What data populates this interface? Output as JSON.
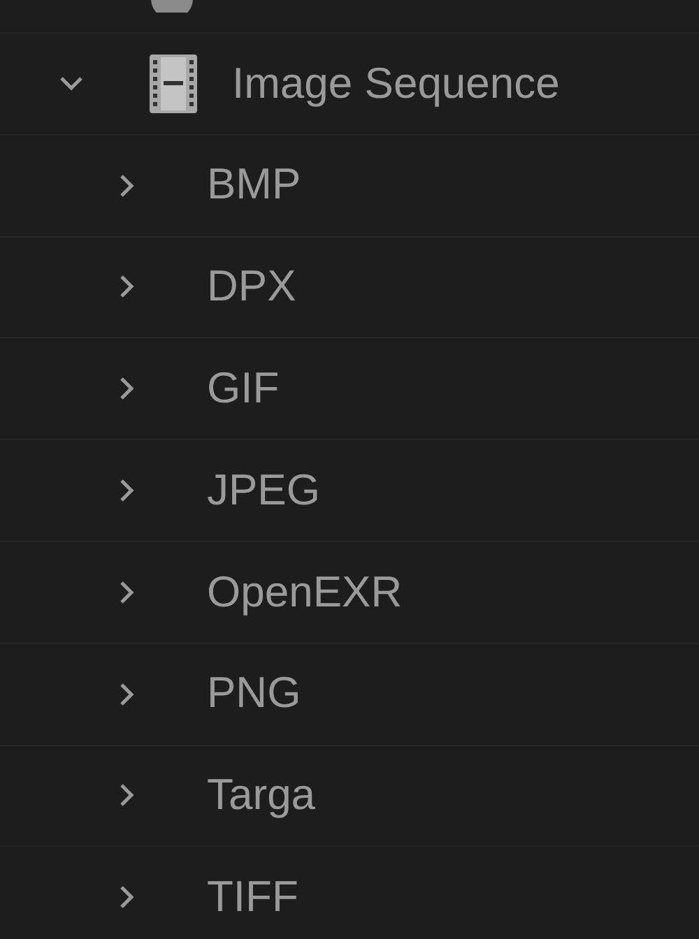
{
  "tree": [
    {
      "label": "Image Sequence",
      "expanded": true,
      "children": [
        {
          "label": "BMP",
          "expanded": false
        },
        {
          "label": "DPX",
          "expanded": false
        },
        {
          "label": "GIF",
          "expanded": false
        },
        {
          "label": "JPEG",
          "expanded": false
        },
        {
          "label": "OpenEXR",
          "expanded": false
        },
        {
          "label": "PNG",
          "expanded": false
        },
        {
          "label": "Targa",
          "expanded": false
        },
        {
          "label": "TIFF",
          "expanded": false
        }
      ]
    }
  ]
}
